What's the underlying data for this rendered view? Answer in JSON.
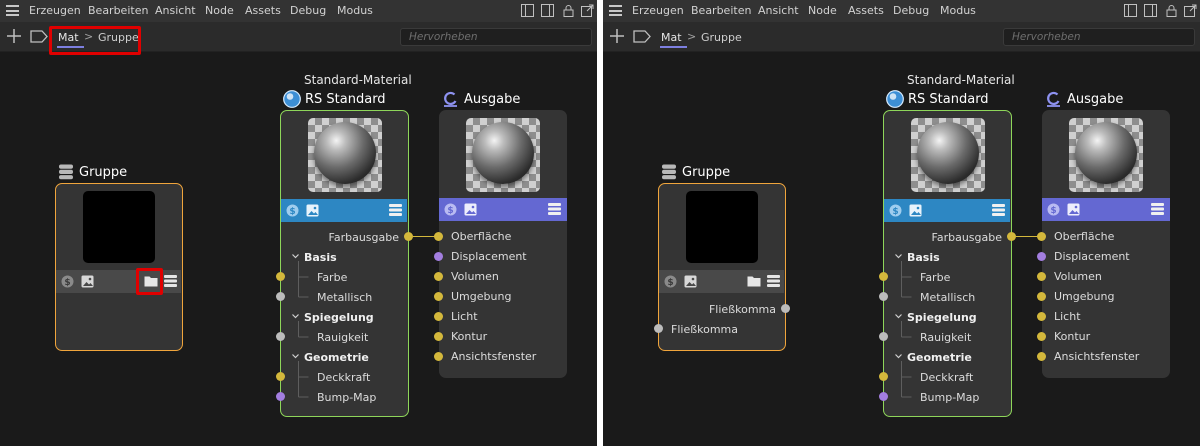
{
  "menu": {
    "items": [
      "Erzeugen",
      "Bearbeiten",
      "Ansicht",
      "Node",
      "Assets",
      "Debug",
      "Modus"
    ]
  },
  "breadcrumb": {
    "root": "Mat",
    "separator": ">",
    "current": "Gruppe"
  },
  "search": {
    "placeholder": "Hervorheben"
  },
  "nodes": {
    "gruppe": {
      "title": "Gruppe"
    },
    "rs_standard": {
      "subtitle": "Standard-Material",
      "title": "RS Standard",
      "output": "Farbausgabe",
      "groups": [
        "Basis",
        "Spiegelung",
        "Geometrie"
      ],
      "basis_ports": [
        "Farbe",
        "Metallisch"
      ],
      "spiegelung_ports": [
        "Rauigkeit"
      ],
      "geometrie_ports": [
        "Deckkraft",
        "Bump-Map"
      ]
    },
    "ausgabe": {
      "title": "Ausgabe",
      "ports": [
        "Oberfläche",
        "Displacement",
        "Volumen",
        "Umgebung",
        "Licht",
        "Kontur",
        "Ansichtsfenster"
      ]
    }
  },
  "gruppe_ports": {
    "output": "Fließkomma",
    "input": "Fließkomma"
  },
  "colors": {
    "accent": "#7d7fe0",
    "highlight": "#e00000",
    "rs_header": "#2d87c3",
    "ausgabe_header": "#6468d2",
    "gruppe_border": "#f0a53c",
    "rs_border": "#8ed65a",
    "port_yellow": "#d4b83c",
    "port_gray": "#bcbcbc",
    "port_purple": "#a37ee0"
  }
}
